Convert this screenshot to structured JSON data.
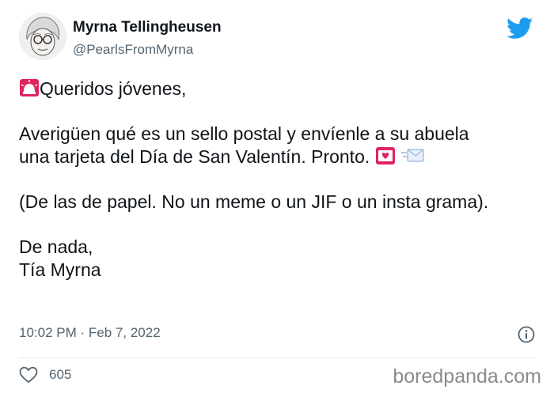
{
  "author": {
    "name": "Myrna Tellingheusen",
    "handle": "@PearlsFromMyrna"
  },
  "icons": {
    "avatar": "elderly-woman-avatar",
    "platform": "twitter-bird-icon",
    "alarm": "rotating-light-emoji",
    "heart_letter": "love-letter-emoji",
    "envelope": "incoming-envelope-emoji",
    "info": "info-icon",
    "like": "heart-icon"
  },
  "tweet": {
    "line1": "Queridos jóvenes,",
    "line2": " Averigüen qué es un sello postal y envíenle a su abuela",
    "line3": "una tarjeta del Día de San Valentín. Pronto.",
    "line4": "(De las de papel. No un meme o un JIF o un insta grama).",
    "line5": "De nada,",
    "line6": "Tía Myrna"
  },
  "meta": {
    "time": "10:02 PM",
    "separator": "·",
    "date": "Feb 7, 2022"
  },
  "likes": "605",
  "watermark": "boredpanda.com",
  "colors": {
    "twitter_blue": "#1d9bf0",
    "text": "#0f1419",
    "muted": "#536471",
    "alarm_red": "#e0245e"
  }
}
